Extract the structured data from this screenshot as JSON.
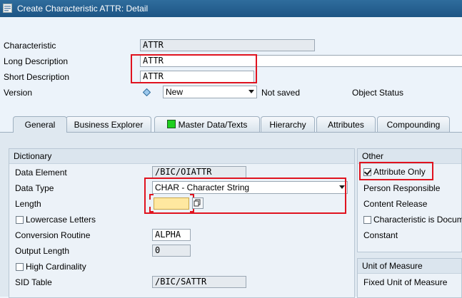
{
  "window": {
    "title": "Create Characteristic ATTR: Detail"
  },
  "header": {
    "characteristic": {
      "label": "Characteristic",
      "value": "ATTR"
    },
    "long_description": {
      "label": "Long Description",
      "value": "ATTR"
    },
    "short_description": {
      "label": "Short Description",
      "value": "ATTR"
    },
    "version": {
      "label": "Version",
      "value": "New",
      "status": "Not saved"
    },
    "object_status": {
      "label": "Object Status"
    }
  },
  "tabs": [
    {
      "label": "General",
      "active": true
    },
    {
      "label": "Business Explorer"
    },
    {
      "label": "Master Data/Texts",
      "icon": "green-status-icon"
    },
    {
      "label": "Hierarchy"
    },
    {
      "label": "Attributes"
    },
    {
      "label": "Compounding"
    }
  ],
  "dictionary": {
    "title": "Dictionary",
    "data_element": {
      "label": "Data Element",
      "value": "/BIC/OIATTR"
    },
    "data_type": {
      "label": "Data Type",
      "value": "CHAR - Character String"
    },
    "length": {
      "label": "Length",
      "value": ""
    },
    "lowercase": {
      "label": "Lowercase Letters",
      "checked": false
    },
    "conversion_routine": {
      "label": "Conversion Routine",
      "value": "ALPHA"
    },
    "output_length": {
      "label": "Output Length",
      "value": "0"
    },
    "high_cardinality": {
      "label": "High Cardinality",
      "checked": false
    },
    "sid_table": {
      "label": "SID Table",
      "value": "/BIC/SATTR"
    }
  },
  "other": {
    "title": "Other",
    "attribute_only": {
      "label": "Attribute Only",
      "checked": true
    },
    "person_responsible": {
      "label": "Person Responsible"
    },
    "content_release": {
      "label": "Content Release"
    },
    "characteristic_doc": {
      "label": "Characteristic is Docum",
      "checked": false
    },
    "constant": {
      "label": "Constant"
    }
  },
  "unit_of_measure": {
    "title": "Unit of Measure",
    "fixed_unit": {
      "label": "Fixed Unit of Measure"
    }
  },
  "colors": {
    "highlight": "#e0131f",
    "titlebar": "#1d5584",
    "input_focus": "#ffe8a0"
  }
}
